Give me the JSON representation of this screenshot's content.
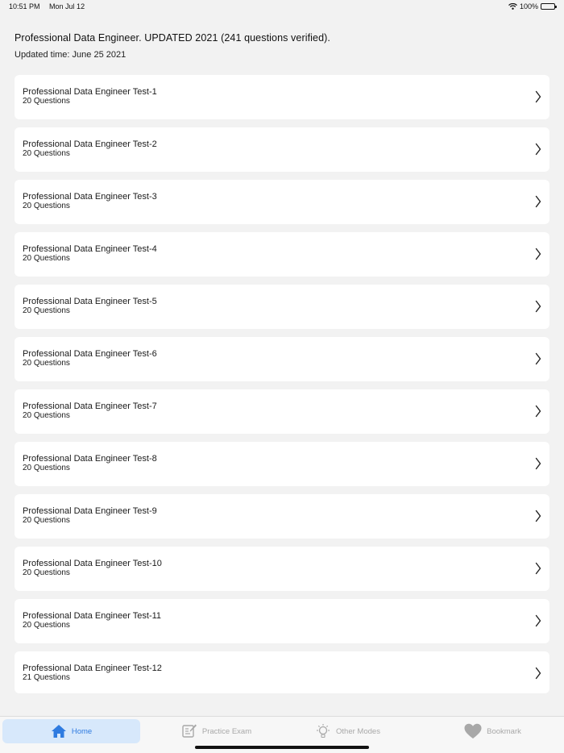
{
  "status_bar": {
    "time": "10:51 PM",
    "date": "Mon Jul 12",
    "battery": "100%"
  },
  "header": {
    "title": "Professional Data Engineer. UPDATED 2021 (241 questions verified).",
    "updated": "Updated time: June 25 2021"
  },
  "tests": [
    {
      "title": "Professional Data Engineer Test-1",
      "count": "20 Questions"
    },
    {
      "title": "Professional Data Engineer Test-2",
      "count": "20 Questions"
    },
    {
      "title": "Professional Data Engineer Test-3",
      "count": "20 Questions"
    },
    {
      "title": "Professional Data Engineer Test-4",
      "count": "20 Questions"
    },
    {
      "title": "Professional Data Engineer Test-5",
      "count": "20 Questions"
    },
    {
      "title": "Professional Data Engineer Test-6",
      "count": "20 Questions"
    },
    {
      "title": "Professional Data Engineer Test-7",
      "count": "20 Questions"
    },
    {
      "title": "Professional Data Engineer Test-8",
      "count": "20 Questions"
    },
    {
      "title": "Professional Data Engineer Test-9",
      "count": "20 Questions"
    },
    {
      "title": "Professional Data Engineer Test-10",
      "count": "20 Questions"
    },
    {
      "title": "Professional Data Engineer Test-11",
      "count": "20 Questions"
    },
    {
      "title": "Professional Data Engineer Test-12",
      "count": "21 Questions"
    }
  ],
  "tab_bar": {
    "home": "Home",
    "practice": "Practice Exam",
    "other": "Other Modes",
    "bookmark": "Bookmark"
  },
  "colors": {
    "accent": "#2f7be0",
    "active_tab_bg": "#d7e8fb",
    "inactive": "#a8a8a8",
    "background": "#f2f2f2"
  },
  "icons": {
    "home": "home-icon",
    "practice": "exam-icon",
    "other": "lightbulb-icon",
    "bookmark": "heart-icon",
    "row": "chevron-right-icon"
  }
}
